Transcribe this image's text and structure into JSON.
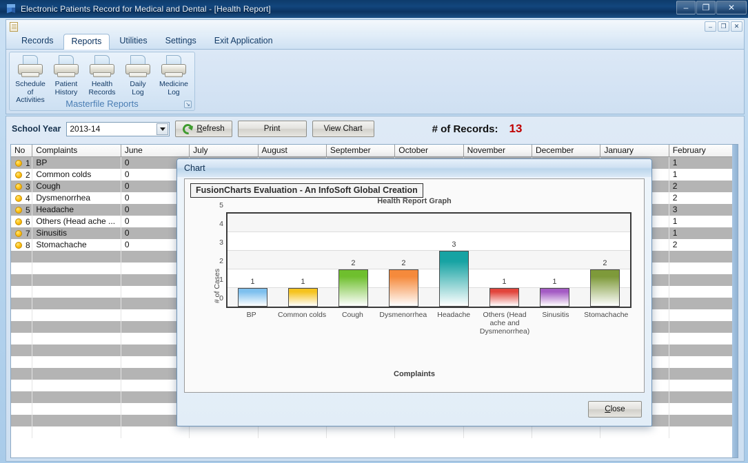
{
  "window": {
    "title": "Electronic Patients Record for Medical and Dental  - [Health Report]",
    "minimize": "–",
    "maximize": "❐",
    "close": "✕"
  },
  "mdi": {
    "minimize": "–",
    "restore": "❐",
    "close": "✕"
  },
  "tabs": [
    {
      "label": "Records",
      "active": false
    },
    {
      "label": "Reports",
      "active": true
    },
    {
      "label": "Utilities",
      "active": false
    },
    {
      "label": "Settings",
      "active": false
    },
    {
      "label": "Exit Application",
      "active": false
    }
  ],
  "ribbon": {
    "group_title": "Masterfile Reports",
    "launcher": "↘",
    "items": [
      {
        "line1": "Schedule of",
        "line2": "Activities"
      },
      {
        "line1": "Patient",
        "line2": "History"
      },
      {
        "line1": "Health",
        "line2": "Records"
      },
      {
        "line1": "Daily",
        "line2": "Log"
      },
      {
        "line1": "Medicine",
        "line2": "Log"
      }
    ]
  },
  "toolbar": {
    "school_year_label": "School Year",
    "school_year_value": "2013-14",
    "refresh_label": "Refresh",
    "print_label": "Print",
    "view_chart_label": "View Chart",
    "records_label": "# of Records:",
    "records_count": "13",
    "records_color": "#c00000"
  },
  "grid": {
    "columns": [
      "No",
      "Complaints",
      "June",
      "July",
      "August",
      "September",
      "October",
      "November",
      "December",
      "January",
      "February"
    ],
    "rows": [
      {
        "no": "1",
        "complaints": "BP",
        "june": "0",
        "february": "1"
      },
      {
        "no": "2",
        "complaints": "Common colds",
        "june": "0",
        "february": "1"
      },
      {
        "no": "3",
        "complaints": "Cough",
        "june": "0",
        "february": "2"
      },
      {
        "no": "4",
        "complaints": "Dysmenorrhea",
        "june": "0",
        "february": "2"
      },
      {
        "no": "5",
        "complaints": "Headache",
        "june": "0",
        "february": "3"
      },
      {
        "no": "6",
        "complaints": "Others (Head ache ...",
        "june": "0",
        "february": "1"
      },
      {
        "no": "7",
        "complaints": "Sinusitis",
        "june": "0",
        "february": "1"
      },
      {
        "no": "8",
        "complaints": "Stomachache",
        "june": "0",
        "february": "2"
      }
    ]
  },
  "dialog": {
    "title": "Chart",
    "close_label": "Close"
  },
  "chart_data": {
    "type": "bar",
    "caption": "FusionCharts Evaluation - An InfoSoft Global Creation",
    "title": "Health Report Graph",
    "xlabel": "Complaints",
    "ylabel": "# of Cases",
    "categories": [
      "BP",
      "Common colds",
      "Cough",
      "Dysmenorrhea",
      "Headache",
      "Others (Head ache and Dysmenorrhea)",
      "Sinusitis",
      "Stomachache"
    ],
    "values": [
      1,
      1,
      2,
      2,
      3,
      1,
      1,
      2
    ],
    "colors": [
      "#7EC0EE",
      "#F5C31E",
      "#6FBF2E",
      "#F58A3C",
      "#17A3A3",
      "#E2453C",
      "#A45BC4",
      "#7E9A3A"
    ],
    "ylim": [
      0,
      5
    ],
    "yticks": [
      0,
      1,
      2,
      3,
      4,
      5
    ],
    "grid": true,
    "legend": "none",
    "data_labels": true
  }
}
